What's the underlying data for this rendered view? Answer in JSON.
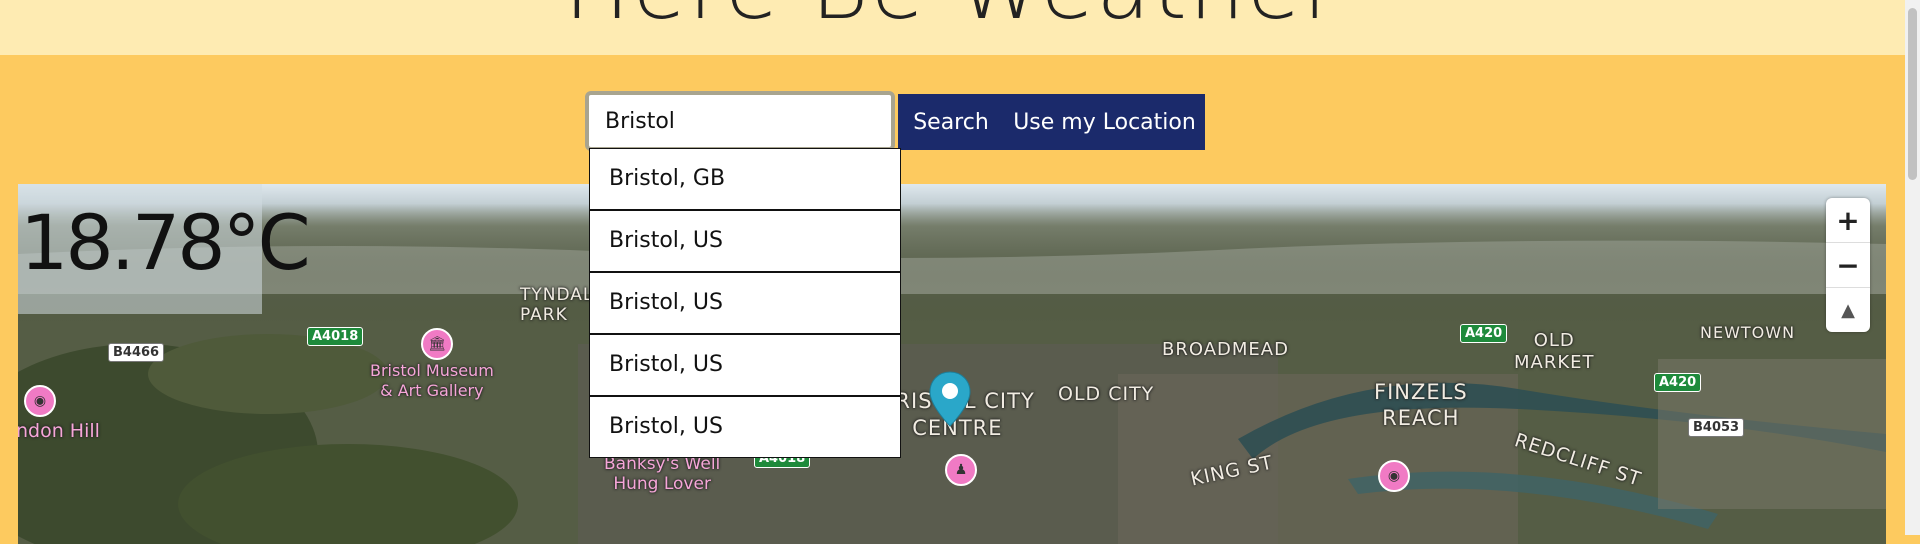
{
  "header": {
    "title": "Here Be Weather"
  },
  "search": {
    "value": "Bristol",
    "search_label": "Search",
    "location_label": "Use my Location"
  },
  "suggestions": [
    "Bristol, GB",
    "Bristol, US",
    "Bristol, US",
    "Bristol, US",
    "Bristol, US"
  ],
  "weather": {
    "temperature": "18.78°C"
  },
  "map": {
    "zoom_in": "+",
    "zoom_out": "−",
    "compass": "▲",
    "place_labels": {
      "tyndall_park": "TYNDALL\nPARK",
      "broadmead": "BROADMEAD",
      "old_market": "OLD\nMARKET",
      "newtown": "NEWTOWN",
      "old_city": "OLD CITY",
      "city_centre": "BRISTOL CITY\nCENTRE",
      "finzels_reach": "FINZELS\nREACH",
      "king_st": "KING ST",
      "redcliff_st": "REDCLIFF ST",
      "brandon_hill": "ndon Hill"
    },
    "poi_labels": {
      "museum": "Bristol Museum\n& Art Gallery",
      "banksy": "Banksy's Well\nHung Lover"
    },
    "roads": {
      "a4018_top": "A4018",
      "a4018_bottom": "A4018",
      "a420_top": "A420",
      "a420_right": "A420",
      "b4466": "B4466",
      "b4053": "B4053"
    },
    "colors": {
      "road_green": "#1e8a3b",
      "poi_pink": "#f07ac4",
      "pin_blue": "#2aa7c9"
    }
  },
  "colors": {
    "header_bg": "#feebb2",
    "page_bg": "#fdca5f",
    "button_bg": "#1b2a6b"
  }
}
